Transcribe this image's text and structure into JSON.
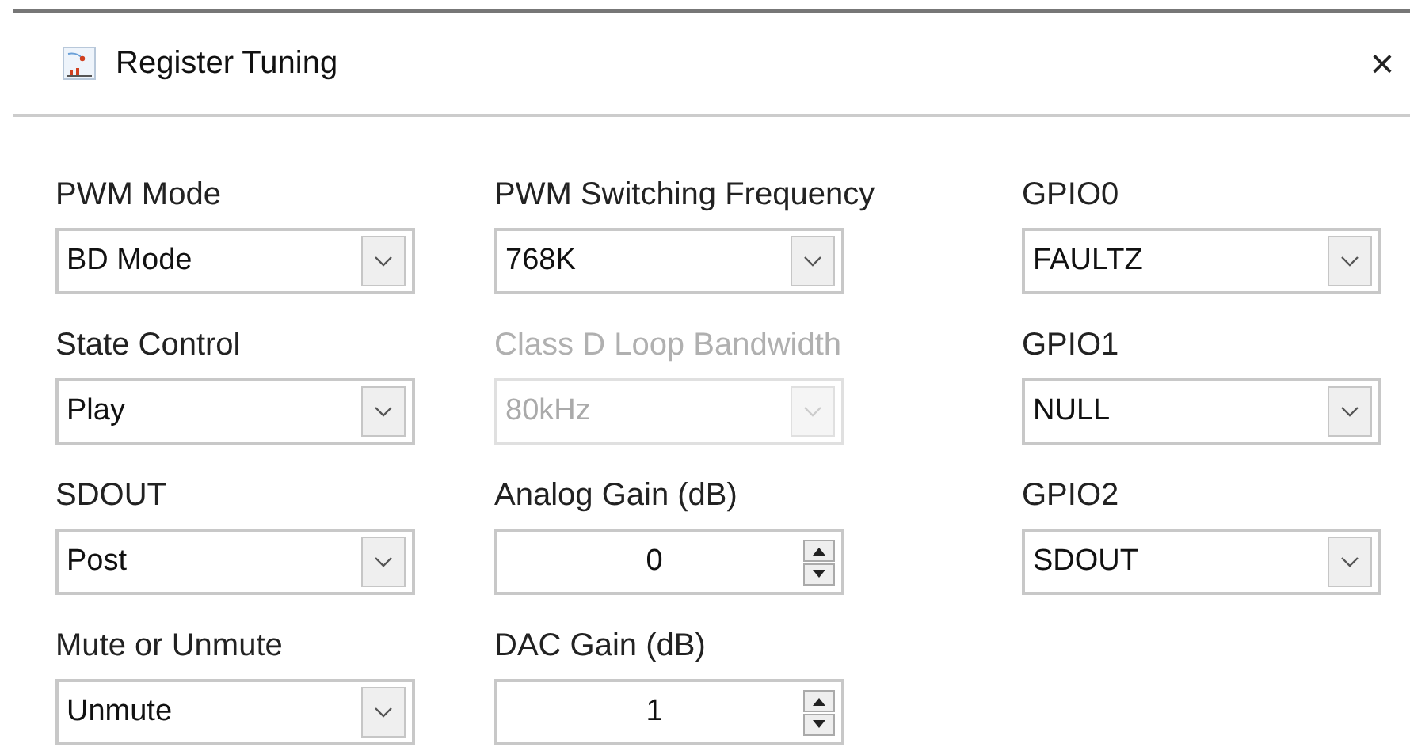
{
  "window": {
    "title": "Register Tuning",
    "close": "×"
  },
  "columns": [
    [
      {
        "label": "PWM Mode",
        "kind": "combo",
        "value": "BD Mode",
        "disabled": false
      },
      {
        "label": "State Control",
        "kind": "combo",
        "value": "Play",
        "disabled": false
      },
      {
        "label": "SDOUT",
        "kind": "combo",
        "value": "Post",
        "disabled": false
      },
      {
        "label": "Mute or Unmute",
        "kind": "combo",
        "value": "Unmute",
        "disabled": false
      }
    ],
    [
      {
        "label": "PWM Switching Frequency",
        "kind": "combo",
        "value": "768K",
        "disabled": false
      },
      {
        "label": "Class D Loop Bandwidth",
        "kind": "combo",
        "value": "80kHz",
        "disabled": true
      },
      {
        "label": "Analog Gain (dB)",
        "kind": "spin",
        "value": "0",
        "disabled": false
      },
      {
        "label": "DAC Gain (dB)",
        "kind": "spin",
        "value": "1",
        "disabled": false
      }
    ],
    [
      {
        "label": "GPIO0",
        "kind": "combo",
        "value": "FAULTZ",
        "disabled": false
      },
      {
        "label": "GPIO1",
        "kind": "combo",
        "value": "NULL",
        "disabled": false
      },
      {
        "label": "GPIO2",
        "kind": "combo",
        "value": "SDOUT",
        "disabled": false
      }
    ]
  ]
}
